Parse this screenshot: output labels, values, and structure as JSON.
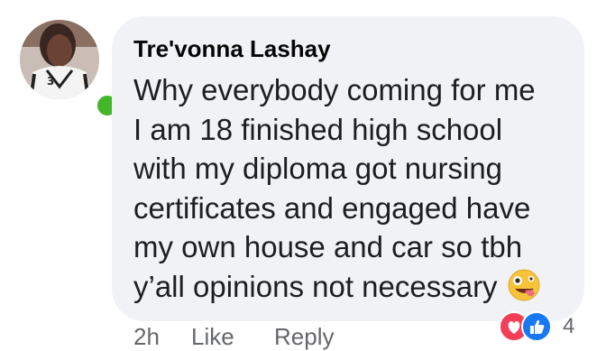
{
  "comment": {
    "author": "Tre'vonna Lashay",
    "lines": [
      "Why everybody coming for me",
      "I am 18 finished high school",
      "with my diploma got nursing",
      "certificates and engaged have",
      "my own house and car so tbh",
      "y’all opinions not necessary"
    ],
    "emoji": "zany-face"
  },
  "actions": {
    "timestamp": "2h",
    "like_label": "Like",
    "reply_label": "Reply"
  },
  "reactions": {
    "icons": [
      "heart-icon",
      "thumbs-up-icon"
    ],
    "count": "4"
  },
  "colors": {
    "bubble": "#f0f2f5",
    "online": "#42b72a",
    "like": "#1877f2",
    "love": "#f33e58",
    "meta_text": "#65676b"
  }
}
